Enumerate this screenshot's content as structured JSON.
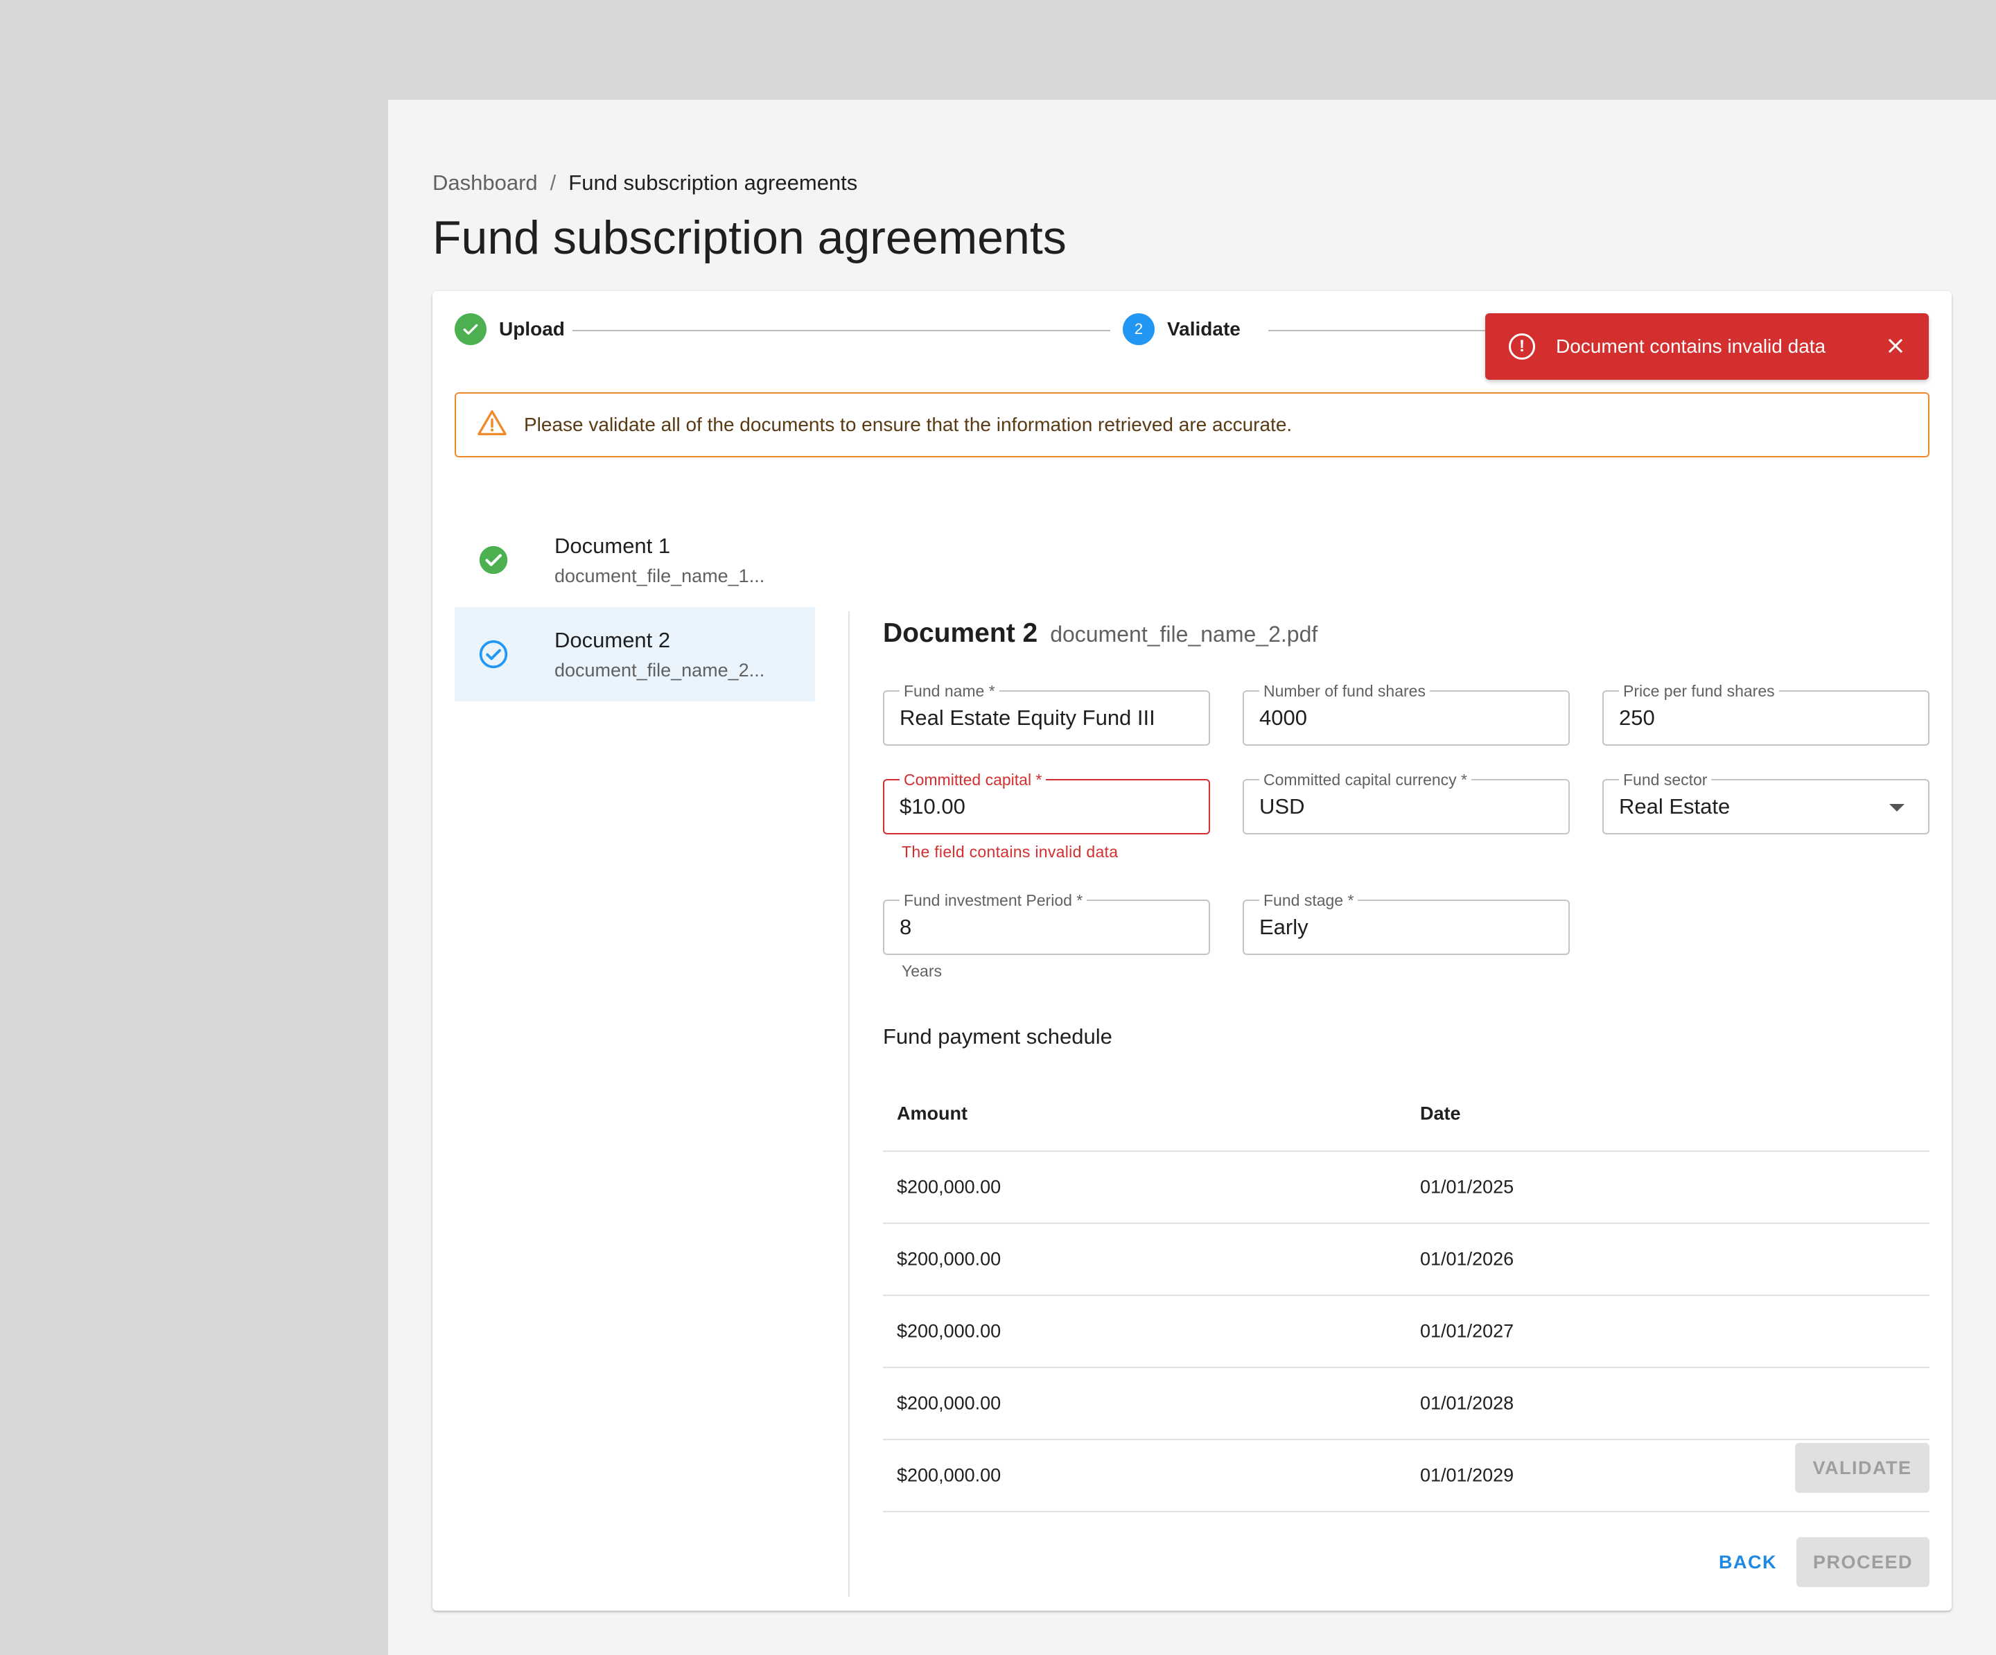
{
  "breadcrumb": {
    "parent": "Dashboard",
    "separator": "/",
    "current": "Fund subscription agreements"
  },
  "page": {
    "title": "Fund subscription agreements"
  },
  "stepper": {
    "steps": [
      {
        "label": "Upload",
        "state": "done"
      },
      {
        "label": "Validate",
        "state": "active",
        "number": "2"
      }
    ]
  },
  "toast": {
    "message": "Document contains invalid data",
    "icon": "error-circle-icon",
    "color": "#d32f2f"
  },
  "alert": {
    "message": "Please validate all of the documents to ensure that the information retrieved are accurate.",
    "icon": "warning-triangle-icon",
    "color": "#ef8a2a"
  },
  "documents": [
    {
      "title": "Document 1",
      "file": "document_file_name_1...",
      "status": "validated"
    },
    {
      "title": "Document 2",
      "file": "document_file_name_2...",
      "status": "current"
    }
  ],
  "detail": {
    "title": "Document 2",
    "file": "document_file_name_2.pdf",
    "fields": {
      "fund_name": {
        "label": "Fund name *",
        "value": "Real Estate Equity Fund III"
      },
      "fund_shares": {
        "label": "Number of fund shares",
        "value": "4000"
      },
      "price_per_share": {
        "label": "Price per fund shares",
        "value": "250"
      },
      "committed_capital": {
        "label": "Committed capital *",
        "value": "$10.00",
        "error": "The field contains invalid data"
      },
      "currency": {
        "label": "Committed capital currency *",
        "value": "USD"
      },
      "sector": {
        "label": "Fund sector",
        "value": "Real Estate"
      },
      "investment_period": {
        "label": "Fund investment Period *",
        "value": "8",
        "helper": "Years"
      },
      "stage": {
        "label": "Fund stage *",
        "value": "Early"
      }
    },
    "schedule": {
      "title": "Fund payment schedule",
      "columns": [
        "Amount",
        "Date"
      ],
      "rows": [
        {
          "amount": "$200,000.00",
          "date": "01/01/2025"
        },
        {
          "amount": "$200,000.00",
          "date": "01/01/2026"
        },
        {
          "amount": "$200,000.00",
          "date": "01/01/2027"
        },
        {
          "amount": "$200,000.00",
          "date": "01/01/2028"
        },
        {
          "amount": "$200,000.00",
          "date": "01/01/2029"
        }
      ]
    }
  },
  "actions": {
    "validate": "VALIDATE",
    "back": "BACK",
    "proceed": "PROCEED"
  }
}
